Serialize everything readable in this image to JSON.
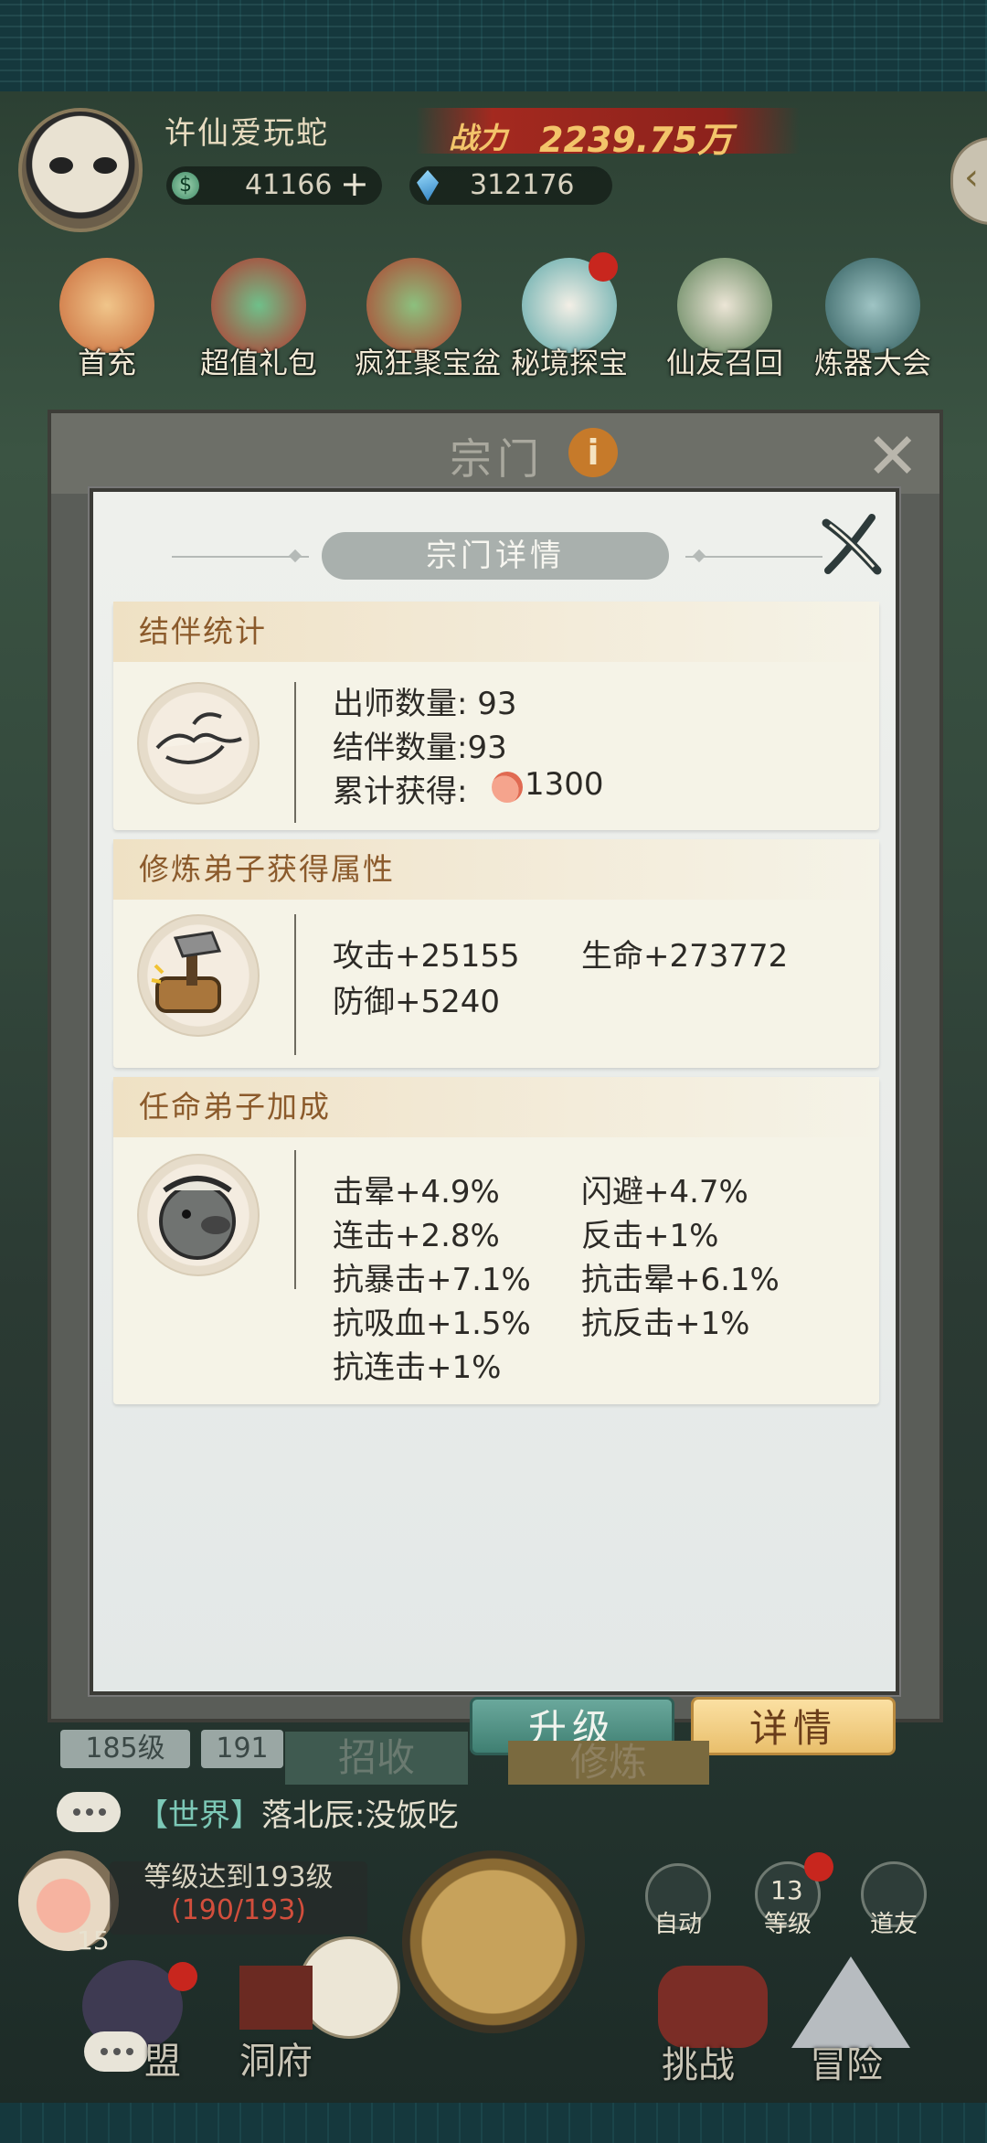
{
  "header": {
    "player_name": "许仙爱玩蛇",
    "power_label": "战力",
    "power_value": "2239.75万",
    "currency_1": "41166",
    "currency_2": "312176",
    "events": [
      "首充",
      "超值礼包",
      "疯狂聚宝盆",
      "秘境探宝",
      "仙友召回",
      "炼器大会"
    ]
  },
  "outer_panel": {
    "title": "宗门"
  },
  "dialog": {
    "title": "宗门详情",
    "sections": [
      {
        "title": "结伴统计",
        "lines": [
          "出师数量: 93",
          "结伴数量:93",
          "累计获得:"
        ],
        "reward_value": "1300"
      },
      {
        "title": "修炼弟子获得属性",
        "stats": [
          "攻击+25155",
          "生命+273772",
          "防御+5240"
        ]
      },
      {
        "title": "任命弟子加成",
        "stats": [
          "击晕+4.9%",
          "闪避+4.7%",
          "连击+2.8%",
          "反击+1%",
          "抗暴击+7.1%",
          "抗击晕+6.1%",
          "抗吸血+1.5%",
          "抗反击+1%",
          "抗连击+1%"
        ]
      }
    ]
  },
  "buttons": {
    "upgrade": "升级",
    "details": "详情"
  },
  "below": {
    "level_a": "185级",
    "level_b": "191",
    "tab_recruit": "招收",
    "tab_train": "修炼",
    "chat_channel": "【世界】",
    "chat_message": "落北辰:没饭吃",
    "quest_title": "等级达到193级",
    "quest_progress": "(190/193)",
    "peach_count": "15",
    "auto_label": "自动",
    "level_label": "等级",
    "level_value": "13",
    "daofa_label": "道友",
    "nav": [
      "盟",
      "洞府",
      "挑战",
      "冒险"
    ]
  }
}
